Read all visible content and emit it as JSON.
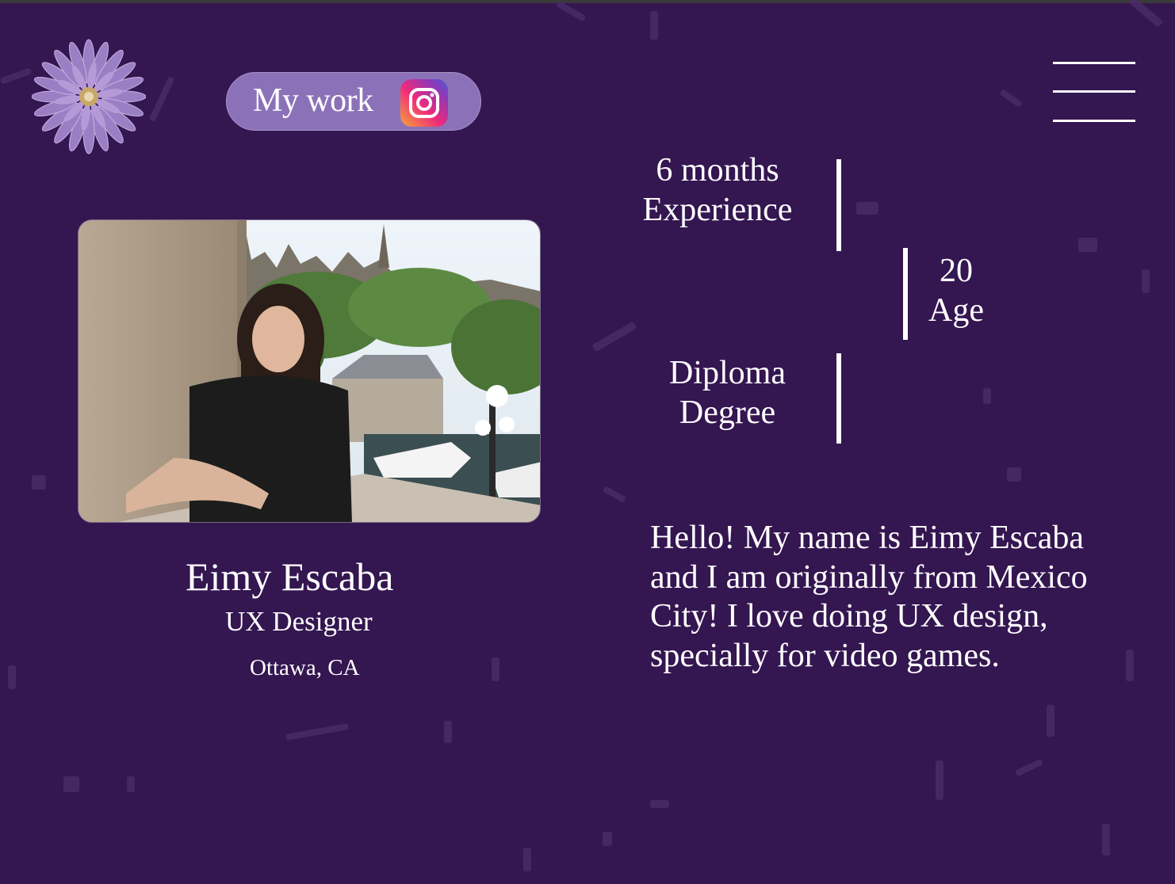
{
  "nav": {
    "my_work_label": "My work",
    "instagram_icon": "instagram-icon",
    "menu_icon": "hamburger-menu-icon",
    "logo_icon": "purple-flower-logo"
  },
  "profile": {
    "name": "Eimy Escaba",
    "role": "UX Designer",
    "location": "Ottawa, CA"
  },
  "stats": [
    {
      "value": "6 months",
      "label": "Experience"
    },
    {
      "value": "20",
      "label": "Age"
    },
    {
      "value": "Diploma",
      "label": "Degree"
    }
  ],
  "bio": "Hello! My name is Eimy Escaba and I am originally from Mexico City! I love doing UX design, specially for video games.",
  "colors": {
    "background": "#341651",
    "pill": "#8b72b8",
    "text": "#ffffff"
  }
}
